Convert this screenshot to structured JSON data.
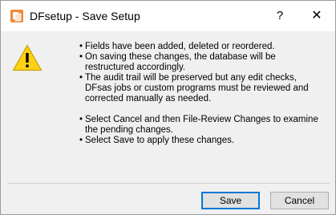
{
  "window": {
    "title": "DFsetup - Save Setup",
    "help_label": "?",
    "close_label": "✕",
    "icon": "dfsetup-app-icon"
  },
  "dialog": {
    "icon": "warning-icon",
    "messages": [
      "Fields have been added, deleted or reordered.",
      "On saving these changes, the database will be restructured accordingly.",
      "The audit trail will be preserved but any edit checks, DFsas jobs or custom programs must be reviewed and corrected manually as needed.",
      "Select Cancel and then File-Review Changes to examine the pending changes.",
      "Select Save to apply these changes."
    ],
    "bullet": "•"
  },
  "buttons": {
    "save": "Save",
    "cancel": "Cancel"
  },
  "colors": {
    "title_bg": "#ffffff",
    "body_bg": "#f0f0f0",
    "warning_yellow": "#fcd116",
    "app_icon_orange": "#f08a3c",
    "default_button_border": "#0078d7"
  }
}
